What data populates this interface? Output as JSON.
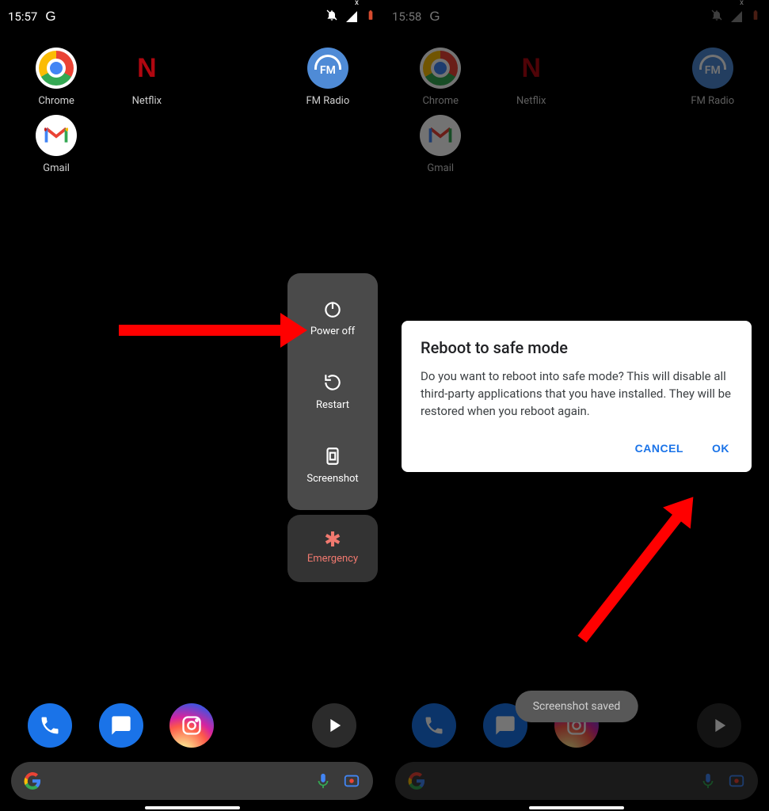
{
  "left": {
    "status": {
      "time": "15:57",
      "indicator": "G",
      "signal_x": "x"
    },
    "apps": [
      {
        "name": "chrome",
        "label": "Chrome"
      },
      {
        "name": "netflix",
        "label": "Netflix",
        "glyph": "N"
      },
      {
        "name": "fmradio",
        "label": "FM Radio",
        "glyph": "FM"
      },
      {
        "name": "gmail",
        "label": "Gmail"
      }
    ],
    "power_menu": {
      "power_off": "Power off",
      "restart": "Restart",
      "screenshot": "Screenshot",
      "emergency": "Emergency"
    }
  },
  "right": {
    "status": {
      "time": "15:58",
      "indicator": "G",
      "signal_x": "x"
    },
    "apps": [
      {
        "name": "chrome",
        "label": "Chrome"
      },
      {
        "name": "netflix",
        "label": "Netflix",
        "glyph": "N"
      },
      {
        "name": "fmradio",
        "label": "FM Radio",
        "glyph": "FM"
      },
      {
        "name": "gmail",
        "label": "Gmail"
      }
    ],
    "dialog": {
      "title": "Reboot to safe mode",
      "body": "Do you want to reboot into safe mode? This will disable all third-party applications that you have installed. They will be restored when you reboot again.",
      "cancel": "CANCEL",
      "ok": "OK"
    },
    "toast": "Screenshot saved"
  },
  "colors": {
    "accent_blue": "#1a73e8",
    "emergency": "#f0796f",
    "arrow": "#ff0000"
  }
}
